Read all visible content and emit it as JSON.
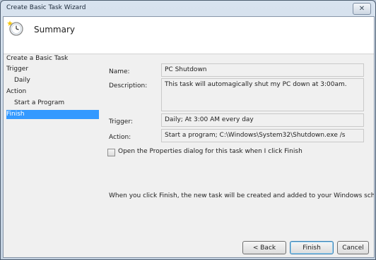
{
  "window": {
    "title": "Create Basic Task Wizard",
    "close_glyph": "✕"
  },
  "header": {
    "title": "Summary",
    "icon": "task-clock-icon"
  },
  "nav": {
    "items": [
      {
        "label": "Create a Basic Task"
      },
      {
        "label": "Trigger"
      },
      {
        "label": "Daily"
      },
      {
        "label": "Action"
      },
      {
        "label": "Start a Program"
      },
      {
        "label": "Finish"
      }
    ],
    "selected": "Finish"
  },
  "summary": {
    "name_label": "Name:",
    "name_value": "PC Shutdown",
    "description_label": "Description:",
    "description_value": "This task will automagically shut my PC down at 3:00am.",
    "trigger_label": "Trigger:",
    "trigger_value": "Daily; At 3:00 AM every day",
    "action_label": "Action:",
    "action_value": "Start a program; C:\\Windows\\System32\\Shutdown.exe /s"
  },
  "open_properties": {
    "label": "Open the Properties dialog for this task when I click Finish",
    "checked": false
  },
  "info_text": "When you click Finish, the new task will be created and added to your Windows schedule.",
  "buttons": {
    "back": "< Back",
    "finish": "Finish",
    "cancel": "Cancel"
  },
  "colors": {
    "selection": "#3399ff",
    "header_bg": "#ffffff",
    "panel_bg": "#f0f0f0"
  }
}
